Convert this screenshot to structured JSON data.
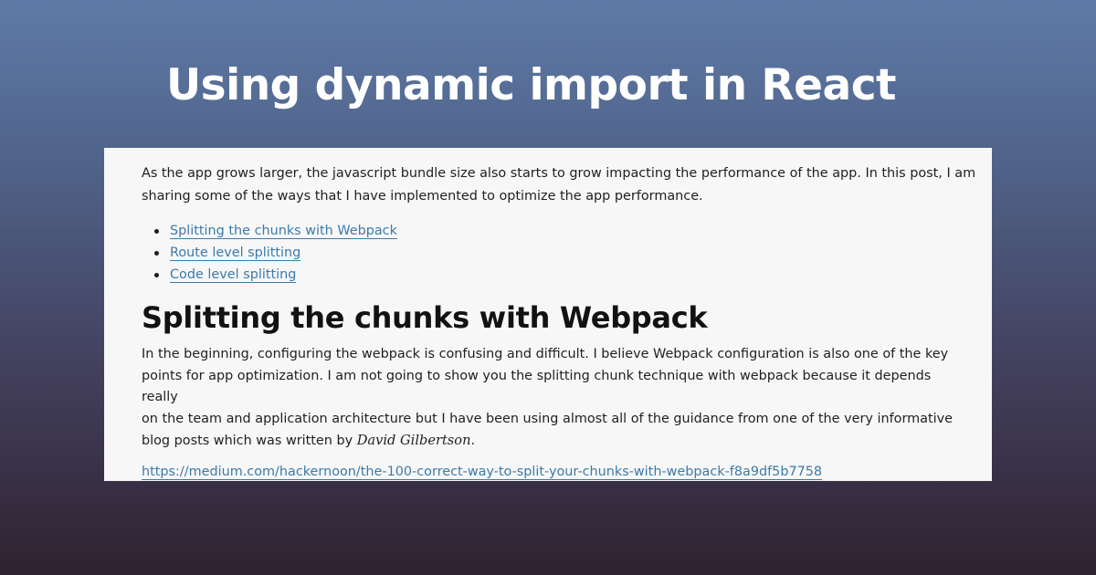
{
  "title": "Using dynamic import in React",
  "article": {
    "intro": "As the app grows larger, the javascript bundle size also starts to grow impacting the performance of the app. In this post, I am sharing some of the ways that I have implemented to optimize the app performance.",
    "intro_line1": "As the app grows larger, the javascript bundle size also starts to grow impacting the performance of the app. In this post, I am",
    "intro_line2": "sharing some of the ways that I have implemented to optimize the app performance.",
    "toc": [
      {
        "label": "Splitting the chunks with Webpack"
      },
      {
        "label": "Route level splitting"
      },
      {
        "label": "Code level splitting"
      }
    ],
    "section_heading": "Splitting the chunks with Webpack",
    "body_line1": "In the beginning, configuring the webpack is confusing and difficult. I believe Webpack configuration is also one of the key",
    "body_line2": "points for app optimization. I am not going to show you the splitting chunk technique with webpack because it depends really",
    "body_line3": "on the team and application architecture but I have been using almost all of the guidance from one of the very informative",
    "body_line4_prefix": "blog posts which was written by ",
    "author": "David Gilbertson",
    "body_line4_suffix": ".",
    "reference_link": "https://medium.com/hackernoon/the-100-correct-way-to-split-your-chunks-with-webpack-f8a9df5b7758"
  },
  "colors": {
    "background_top": "#5e7ba8",
    "background_bottom": "#2f2230",
    "panel": "#f7f7f8",
    "link": "#3d7aa8",
    "title": "#ffffff"
  }
}
